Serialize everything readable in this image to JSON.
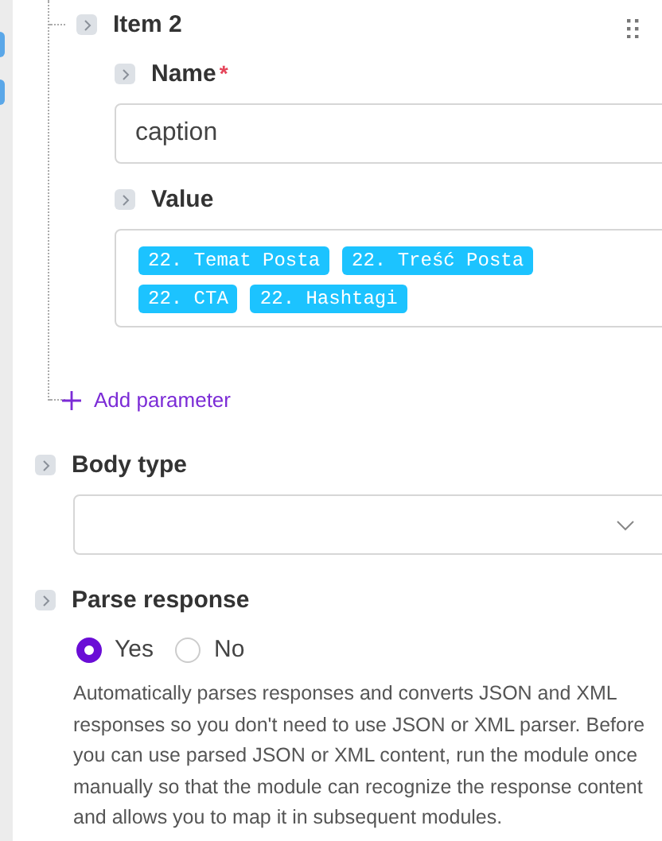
{
  "item": {
    "title": "Item 2",
    "fields": [
      {
        "kind": "text",
        "label": "Name",
        "required_mark": "*",
        "value": "caption"
      },
      {
        "kind": "tags",
        "label": "Value",
        "tags": [
          "22. Temat Posta",
          "22. Treść Posta",
          "22. CTA",
          "22. Hashtagi"
        ]
      }
    ]
  },
  "add_parameter": "Add parameter",
  "body_type": {
    "label": "Body type"
  },
  "parse_response": {
    "label": "Parse response",
    "options": [
      {
        "label": "Yes",
        "selected": true
      },
      {
        "label": "No",
        "selected": false
      }
    ],
    "description": "Automatically parses responses and converts JSON and XML responses so you don't need to use JSON or XML parser. Before you can use parsed JSON or XML content, run the module once manually so that the module can recognize the response content and allows you to map it in subsequent modules."
  }
}
